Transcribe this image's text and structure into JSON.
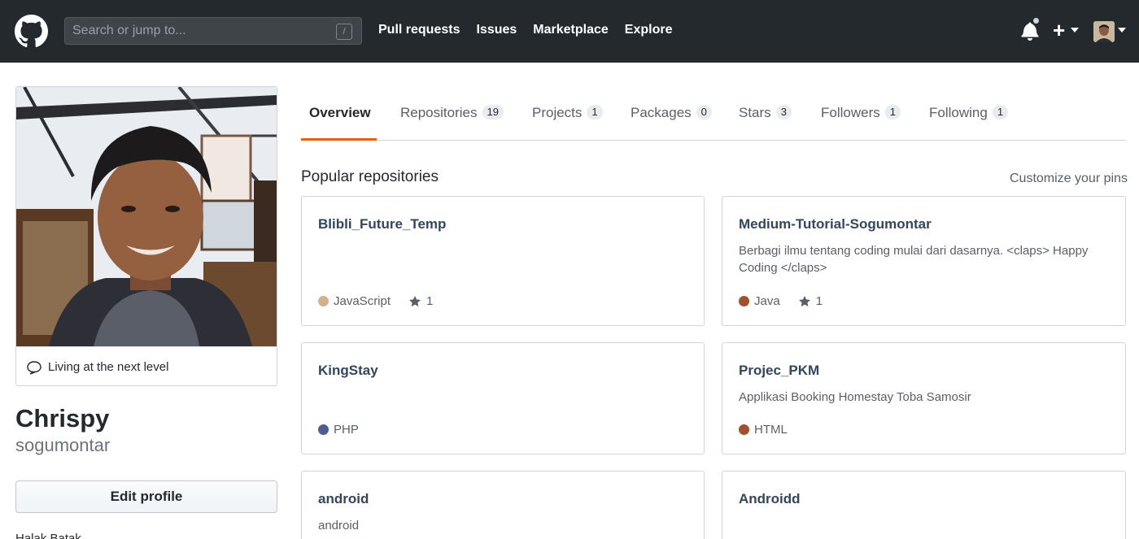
{
  "header": {
    "search_placeholder": "Search or jump to...",
    "search_shortcut": "/",
    "nav": [
      "Pull requests",
      "Issues",
      "Marketplace",
      "Explore"
    ],
    "plus_label": "+"
  },
  "profile": {
    "status": "Living at the next level",
    "fullname": "Chrispy",
    "username": "sogumontar",
    "edit_label": "Edit profile",
    "location": "Halak Batak"
  },
  "tabs": [
    {
      "label": "Overview",
      "count": ""
    },
    {
      "label": "Repositories",
      "count": "19"
    },
    {
      "label": "Projects",
      "count": "1"
    },
    {
      "label": "Packages",
      "count": "0"
    },
    {
      "label": "Stars",
      "count": "3"
    },
    {
      "label": "Followers",
      "count": "1"
    },
    {
      "label": "Following",
      "count": "1"
    }
  ],
  "popular": {
    "title": "Popular repositories",
    "customize": "Customize your pins",
    "repos": [
      {
        "name": "Blibli_Future_Temp",
        "description": "",
        "language": "JavaScript",
        "language_color": "#d1b28c",
        "stars": "1"
      },
      {
        "name": "Medium-Tutorial-Sogumontar",
        "description": "Berbagi ilmu tentang coding mulai dari dasarnya. <claps> Happy Coding </claps>",
        "language": "Java",
        "language_color": "#b07219",
        "stars": "1"
      },
      {
        "name": "KingStay",
        "description": "",
        "language": "PHP",
        "language_color": "#4f5d95",
        "stars": ""
      },
      {
        "name": "Projec_PKM",
        "description": "Applikasi Booking Homestay Toba Samosir",
        "language": "HTML",
        "language_color": "#a0522d",
        "stars": ""
      },
      {
        "name": "android",
        "description": "android",
        "language": "",
        "language_color": "",
        "stars": ""
      },
      {
        "name": "Androidd",
        "description": "",
        "language": "",
        "language_color": "",
        "stars": ""
      }
    ]
  },
  "icons": {
    "logo": "github-mark-icon",
    "bell": "bell-icon",
    "status": "speech-bubble-icon",
    "star": "star-icon"
  }
}
